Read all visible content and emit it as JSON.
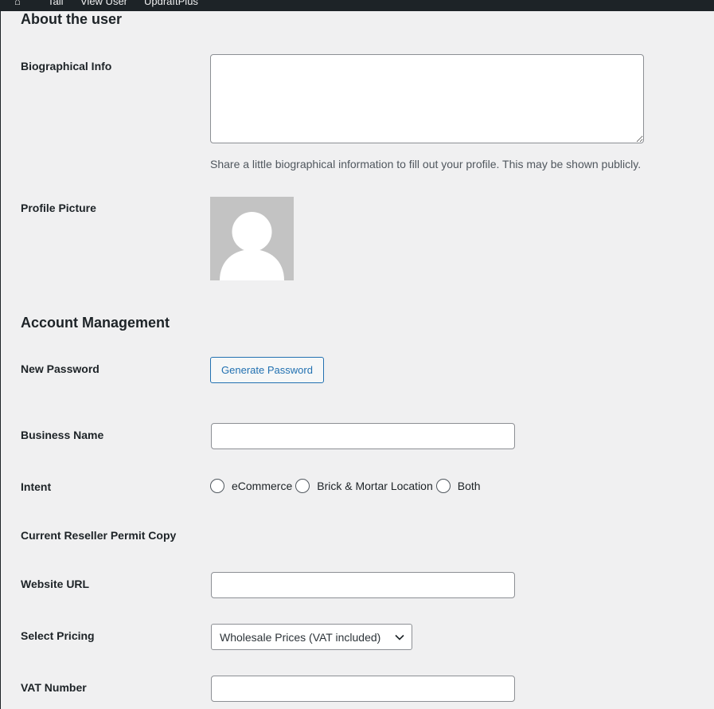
{
  "admin_bar": {
    "items": [
      "Tail",
      "View User",
      "UpdraftPlus"
    ]
  },
  "about_section": {
    "title": "About the user",
    "bio_label": "Biographical Info",
    "bio_value": "",
    "bio_description": "Share a little biographical information to fill out your profile. This may be shown publicly.",
    "picture_label": "Profile Picture"
  },
  "account_section": {
    "title": "Account Management",
    "password_label": "New Password",
    "generate_password_button": "Generate Password"
  },
  "business": {
    "business_name_label": "Business Name",
    "business_name_value": "",
    "intent_label": "Intent",
    "intent_options": [
      "eCommerce",
      "Brick & Mortar Location",
      "Both"
    ],
    "reseller_permit_label": "Current Reseller Permit Copy",
    "website_label": "Website URL",
    "website_value": "",
    "pricing_label": "Select Pricing",
    "pricing_selected": "Wholesale Prices (VAT included)",
    "vat_label": "VAT Number",
    "vat_value": ""
  },
  "colors": {
    "background": "#f0f0f1",
    "admin_bar": "#1d2327",
    "accent": "#2271b1",
    "border": "#8c8f94",
    "avatar_bg": "#c3c3c3"
  },
  "icons": {
    "avatar": "default-avatar-icon",
    "select_chevron": "chevron-down-icon",
    "textarea_resize": "resize-handle-icon"
  }
}
